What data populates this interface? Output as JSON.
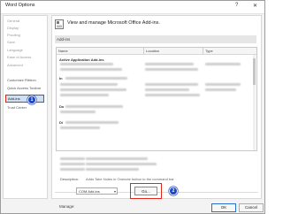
{
  "window": {
    "title": "Word Options",
    "help": "?",
    "close": "✕"
  },
  "sidebar": {
    "items": [
      {
        "label": "General"
      },
      {
        "label": "Display"
      },
      {
        "label": "Proofing"
      },
      {
        "label": "Save"
      },
      {
        "label": "Language"
      },
      {
        "label": "Ease of Access"
      },
      {
        "label": "Advanced"
      },
      {
        "label": "Customize Ribbon"
      },
      {
        "label": "Quick Access Toolbar"
      },
      {
        "label": "Add-ins"
      },
      {
        "label": "Trust Center"
      }
    ],
    "badge_1": "1"
  },
  "main": {
    "header": "View and manage Microsoft Office Add-ins.",
    "section": "Add-ins",
    "columns": {
      "name": "Name",
      "location": "Location",
      "type": "Type"
    },
    "groups": {
      "active": "Active Application Add-ins",
      "inactive": "In",
      "document": "Do",
      "disabled": "Di"
    },
    "details": {
      "description_label": "Description:",
      "description_value": "Adds Take Notes in Onenote button to the command bar"
    },
    "manage": {
      "label": "Manage:",
      "selected": "COM Add-ins",
      "go": "Go...",
      "badge_2": "2"
    }
  },
  "footer": {
    "ok": "OK",
    "cancel": "Cancel"
  },
  "colors": {
    "highlight": "#e0271c",
    "badge": "#1e47c8",
    "selected_bg": "#cfe0f2"
  }
}
